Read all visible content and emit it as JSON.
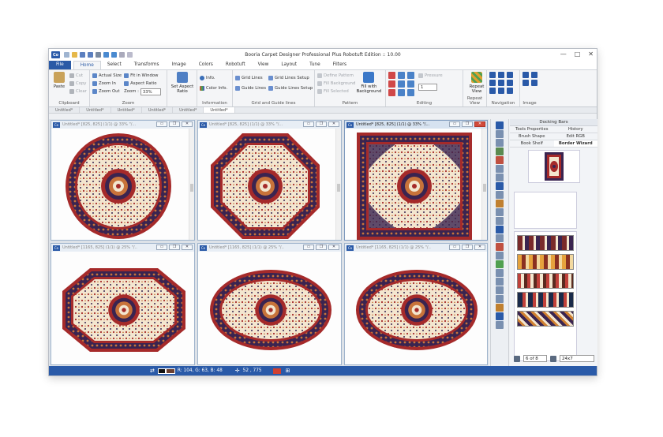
{
  "app": {
    "badge": "Co",
    "title": "Booria Carpet Designer Professional Plus Robotuft Edition :: 10.00",
    "controls": [
      "—",
      "□",
      "✕"
    ]
  },
  "ribbon_tabs": [
    "File",
    "Home",
    "Select",
    "Transforms",
    "Image",
    "Colors",
    "Robotuft",
    "View",
    "Layout",
    "Tune",
    "Filters"
  ],
  "active_tab": "Home",
  "groups": {
    "clipboard": {
      "label": "Clipboard",
      "paste": "Paste",
      "cut": "Cut",
      "copy": "Copy",
      "clear": "Clear"
    },
    "zoom": {
      "label": "Zoom",
      "actual_size": "Actual Size",
      "fit_window": "Fit in Window",
      "zoom_in": "Zoom In",
      "aspect_ratio": "Aspect Ratio",
      "zoom_out": "Zoom Out",
      "zoom_label": "Zoom :",
      "zoom_value": "33%"
    },
    "set_aspect": {
      "label": "Set Aspect Ratio"
    },
    "information": {
      "label": "Information",
      "info": "Info.",
      "color_info": "Color Info."
    },
    "grid": {
      "label": "Grid and Guide lines",
      "grid_lines": "Grid Lines",
      "grid_setup": "Grid Lines Setup",
      "guide_lines": "Guide Lines",
      "guide_setup": "Guide Lines Setup"
    },
    "pattern": {
      "label": "Pattern",
      "define": "Define Pattern",
      "fill_bg": "Fill Background",
      "fill_sel": "Fill Selected",
      "fill_with_bg": "Fill with Background"
    },
    "editing": {
      "label": "Editing",
      "pressure": "Pressure",
      "size_value": "1"
    },
    "repeat": {
      "label": "Repeat View",
      "repeat_view": "Repeat View"
    },
    "navigation": {
      "label": "Navigation"
    },
    "image": {
      "label": "Image"
    }
  },
  "doc_tabs": [
    "Untitled*",
    "Untitled*",
    "Untitled*",
    "Untitled*",
    "Untitled*",
    "Untitled*"
  ],
  "child_windows": [
    {
      "title": "Untitled* [825, 825] (1/1) @ 33% \"/...",
      "shape": "circle",
      "active": false
    },
    {
      "title": "Untitled* [825, 825] (1/1) @ 33% \"/...",
      "shape": "octagon",
      "active": false
    },
    {
      "title": "Untitled* [825, 825] (1/1) @ 33% \"/...",
      "shape": "square",
      "active": true
    },
    {
      "title": "Untitled* [1165, 825] (1/1) @ 25% \"/...",
      "shape": "octagon-wide",
      "active": false
    },
    {
      "title": "Untitled* [1165, 825] (1/1) @ 25% \"/...",
      "shape": "ellipse",
      "active": false
    },
    {
      "title": "Untitled* [1165, 825] (1/1) @ 25% \"/...",
      "shape": "ellipse",
      "active": false
    }
  ],
  "panel": {
    "title": "Docking Bars",
    "tabs": [
      "Tools Properties",
      "History",
      "Brush Shape",
      "Edit RGB",
      "Book Shelf",
      "Border Wizard"
    ],
    "selected_tab": "Border Wizard",
    "page_indicator": "6 of 8",
    "size_value": "24x7"
  },
  "status": {
    "color": "R: 104, G: 63, B: 48",
    "coords": "52 , 775"
  },
  "colors": {
    "brand": "#2a5aa8",
    "rug_dark": "#3a2450",
    "rug_red": "#a52a2a",
    "rug_cream": "#f3e6cf"
  }
}
